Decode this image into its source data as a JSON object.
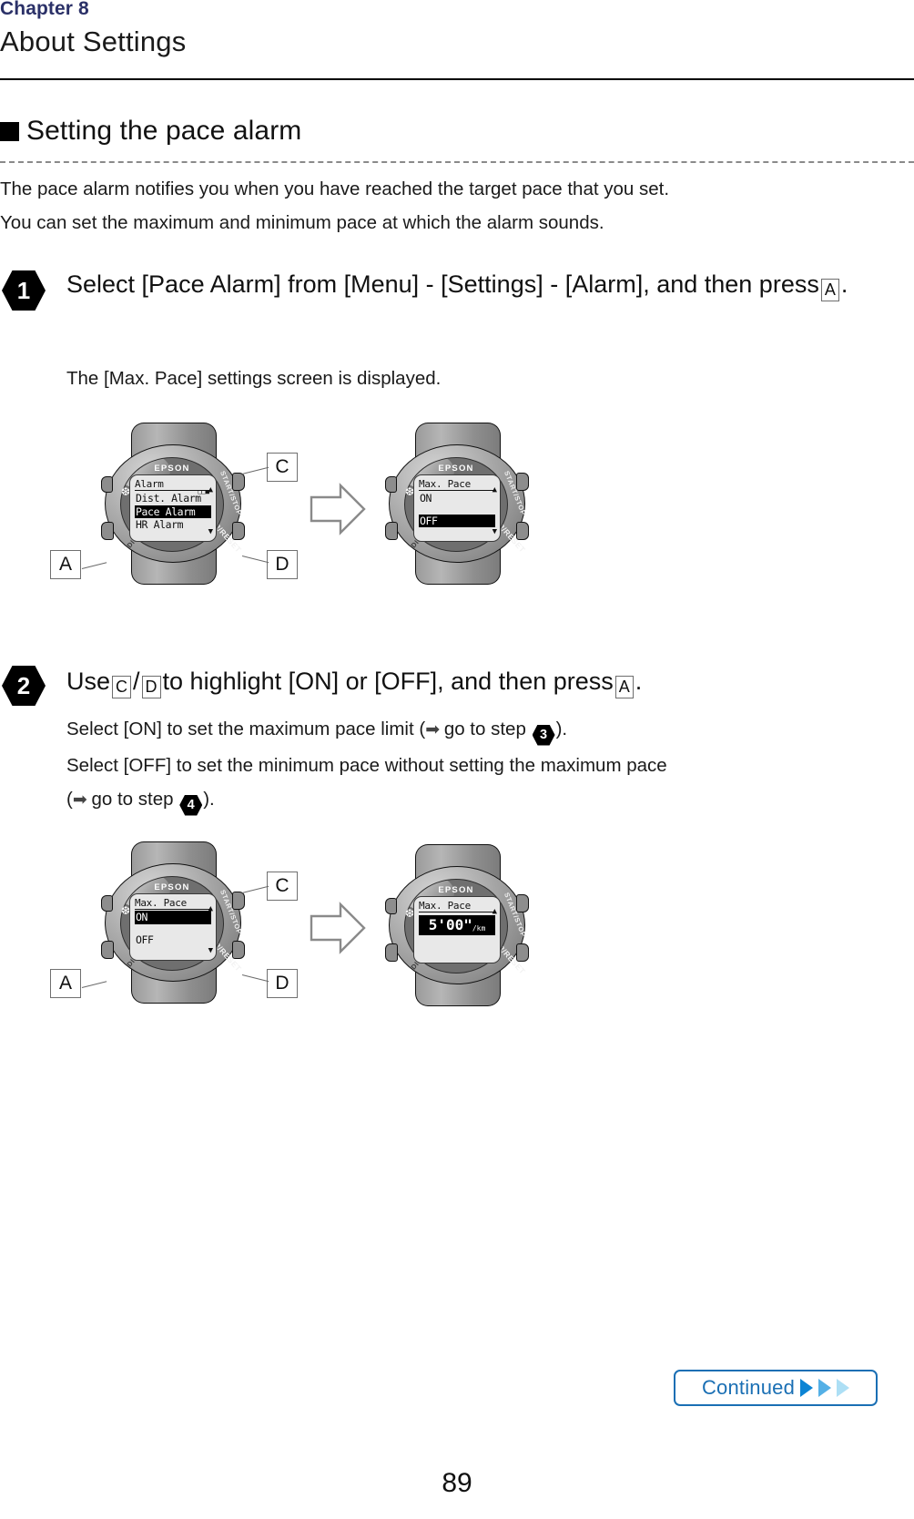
{
  "header": {
    "chapter": "Chapter 8",
    "title": "About Settings"
  },
  "section": {
    "bullet_icon": "black-square-bullet",
    "title": "Setting the pace alarm"
  },
  "intro": {
    "line1": "The pace alarm notifies you when you have reached the target pace that you set.",
    "line2": "You can set the maximum and minimum pace at which the alarm sounds."
  },
  "steps": [
    {
      "number": "1",
      "text_before_key": "Select [Pace Alarm] from [Menu] - [Settings] - [Alarm], and then press",
      "key": "A",
      "text_after_key": ".",
      "sub": "The [Max. Pace] settings screen is displayed."
    },
    {
      "number": "2",
      "text_part1": "Use",
      "key1": "C",
      "separator": "/",
      "key2": "D",
      "text_part2": "to highlight [ON] or [OFF], and then press",
      "key3": "A",
      "text_part3": ".",
      "sub1_before": "Select [ON] to set the maximum pace limit (",
      "sub1_arrow": "➡",
      "sub1_mid": "go to step",
      "sub1_step": "3",
      "sub1_after": ").",
      "sub2": "Select [OFF] to set the minimum pace without setting the maximum pace",
      "sub3_before": "(",
      "sub3_arrow": "➡",
      "sub3_mid": "go to step",
      "sub3_step": "4",
      "sub3_after": ")."
    }
  ],
  "figures": [
    {
      "name": "figure-step-1",
      "watch_left": {
        "brand": "EPSON",
        "screen_title": "Alarm",
        "rows": [
          {
            "label": "Dist. Alarm",
            "highlighted": false
          },
          {
            "label": "Pace Alarm",
            "highlighted": true
          },
          {
            "label": "HR Alarm",
            "highlighted": false
          }
        ],
        "caret_up": "▲",
        "caret_down": "▼",
        "button_labels": {
          "start_stop": "START/STOP",
          "lap_reset": "LAP/RESET",
          "disp_chg": "DISP.CHG"
        }
      },
      "watch_right": {
        "brand": "EPSON",
        "screen_title": "Max. Pace",
        "rows": [
          {
            "label": "ON",
            "highlighted": false
          },
          {
            "label": "OFF",
            "highlighted": true
          }
        ],
        "caret_up": "▲",
        "caret_down": "▼",
        "button_labels": {
          "start_stop": "START/STOP",
          "lap_reset": "LAP/RESET",
          "disp_chg": "DISP.CHG"
        }
      },
      "callouts": {
        "a": "A",
        "c": "C",
        "d": "D"
      }
    },
    {
      "name": "figure-step-2",
      "watch_left": {
        "brand": "EPSON",
        "screen_title": "Max. Pace",
        "rows": [
          {
            "label": "ON",
            "highlighted": true
          },
          {
            "label": "OFF",
            "highlighted": false
          }
        ],
        "caret_up": "▲",
        "caret_down": "▼",
        "button_labels": {
          "start_stop": "START/STOP",
          "lap_reset": "LAP/RESET",
          "disp_chg": "DISP.CHG"
        }
      },
      "watch_right": {
        "brand": "EPSON",
        "screen_title": "Max. Pace",
        "value": "5'00\"",
        "unit": "/km",
        "caret_up": "▲",
        "button_labels": {
          "start_stop": "START/STOP",
          "lap_reset": "LAP/RESET",
          "disp_chg": "DISP.CHG"
        }
      },
      "callouts": {
        "a": "A",
        "c": "C",
        "d": "D"
      }
    }
  ],
  "footer": {
    "continued_label": "Continued",
    "page_number": "89"
  },
  "colors": {
    "chapter_accent": "#2b3168",
    "continued_blue": "#1a6fb4",
    "triangle_1": "#0b84d4",
    "triangle_2": "#54b0e6",
    "triangle_3": "#addff5"
  }
}
